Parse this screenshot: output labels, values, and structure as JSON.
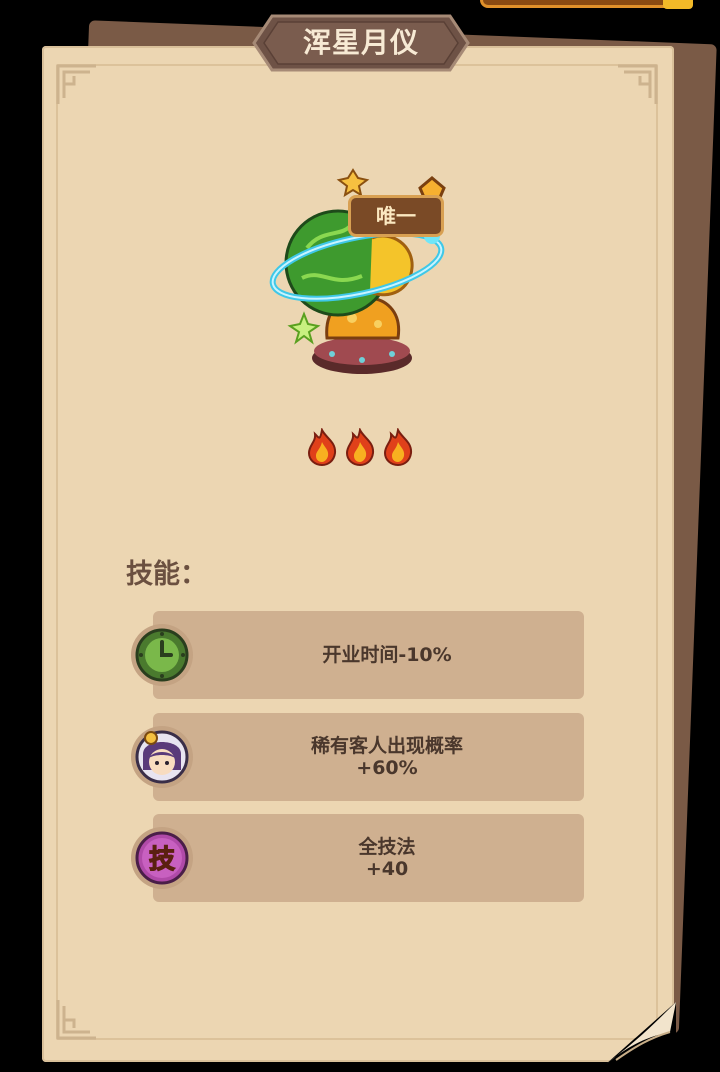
{
  "title": "浑星月仪",
  "item": {
    "name_icon": "armillary-sphere-icon",
    "badge": "唯一",
    "rarity_count": 3,
    "rarity_icon": "flame-icon"
  },
  "skills": {
    "label": "技能：",
    "items": [
      {
        "icon": "clock-icon",
        "line1": "开业时间-10%",
        "line2": ""
      },
      {
        "icon": "customer-portrait-icon",
        "line1": "稀有客人出现概率",
        "line2": "+60%"
      },
      {
        "icon": "skill-badge-icon",
        "icon_text": "技",
        "line1": "全技法",
        "line2": "+40"
      }
    ]
  },
  "colors": {
    "paper": "#ecd6b2",
    "skill_bar": "#cfb090",
    "title_plate": "#7a5c4e",
    "text": "#4a372c"
  }
}
